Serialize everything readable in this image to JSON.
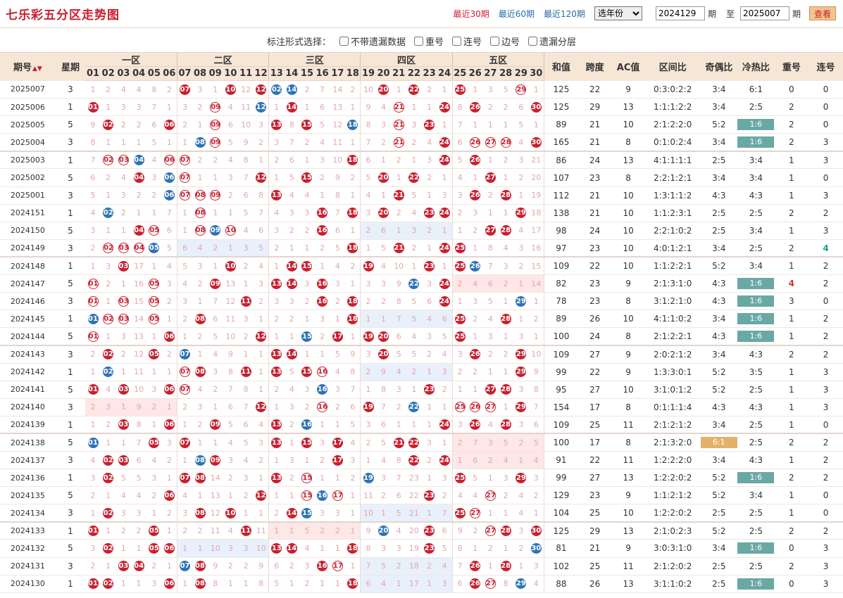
{
  "title": "七乐彩五分区走势图",
  "toolbar": {
    "links": [
      "最近30期",
      "最近60期",
      "最近120期"
    ],
    "year_select": "选年份",
    "from_value": "2024129",
    "issue_suffix": "期",
    "to_label": "至",
    "to_value": "2025007",
    "query": "查看"
  },
  "options": {
    "label": "标注形式选择：",
    "items": [
      "不带遗漏数据",
      "重号",
      "连号",
      "边号",
      "遗漏分层"
    ]
  },
  "headers": {
    "issue": "期号",
    "week": "星期",
    "zones": [
      "一区",
      "二区",
      "三区",
      "四区",
      "五区"
    ],
    "stats": [
      "和值",
      "跨度",
      "AC值",
      "区间比",
      "奇偶比",
      "冷热比",
      "重号",
      "连号"
    ]
  },
  "rows": [
    {
      "issue": "2025007",
      "week": "3",
      "cells": "-1 -2 -4 -4 -8 -2 R7 -3 -1 R10 -12 R12 B2 B14 -2 -7 -14 -2 -10 R20 -1 R22 -2 -1 R25 -1 -3 -5 O29 -1",
      "hs": 125,
      "kd": 22,
      "ac": 9,
      "qj": "0:3:0:2:2",
      "jo": "3:4",
      "lr": "6:1",
      "cf": 0,
      "lh": 0
    },
    {
      "issue": "2025006",
      "week": "1",
      "cells": "R1 -1 -3 -3 -7 -1 -3 -2 O9 -4 -11 B12 -1 R14 -1 -6 -13 -1 -9 -4 O21 -1 -1 R24 -8 R26 -2 -2 -6 R30",
      "hs": 125,
      "kd": 29,
      "ac": 13,
      "qj": "1:1:1:2:2",
      "jo": "3:4",
      "lr": "2:5",
      "cf": 2,
      "lh": 0
    },
    {
      "issue": "2025005",
      "week": "5",
      "cells": "-9 R2 -2 -2 -6 R6 -2 -1 O9 -6 -10 -3 R13 -8 R15 -5 -12 B18 -8 -3 O21 -3 R23 -1 -7 -1 -1 -1 -5 -1",
      "hs": 89,
      "kd": 21,
      "ac": 10,
      "qj": "2:1:2:2:0",
      "jo": "5:2",
      "lr": "1:6",
      "lrBadge": "teal",
      "cf": 2,
      "lh": 0
    },
    {
      "issue": "2025004",
      "week": "3",
      "cells": "-8 -1 -1 -1 -5 -1 -1 B8 O9 -5 -9 -2 -3 -7 -2 -4 -11 -1 -7 -2 O21 -2 -4 R24 -6 O26 O27 O28 -4 R30",
      "hs": 165,
      "kd": 21,
      "ac": 8,
      "qj": "0:1:0:2:4",
      "jo": "3:4",
      "lr": "1:6",
      "lrBadge": "teal",
      "cf": 2,
      "lh": 3,
      "group": true
    },
    {
      "issue": "2025003",
      "week": "1",
      "cells": "-7 O2 O3 B4 -4 O6 O7 -2 -2 -4 -8 -1 -2 -6 -1 -3 -10 R18 -6 -1 -2 -1 -3 R24 -5 R26 -1 -2 -3 -21",
      "hs": 86,
      "kd": 24,
      "ac": 13,
      "qj": "4:1:1:1:1",
      "jo": "2:5",
      "lr": "3:4",
      "cf": 1,
      "lh": 3
    },
    {
      "issue": "2025002",
      "week": "5",
      "cells": "-6 -2 -4 R4 -3 B6 O7 -1 -1 -3 -7 R12 -1 -5 R15 -2 -9 -2 -5 R20 -1 R22 -2 -1 -4 -1 R27 -1 -2 -20",
      "hs": 107,
      "kd": 23,
      "ac": 8,
      "qj": "2:2:1:2:1",
      "jo": "3:4",
      "lr": "3:4",
      "cf": 1,
      "lh": 0
    },
    {
      "issue": "2025001",
      "week": "3",
      "cells": "-5 -1 -3 -2 -2 B6 O7 O8 O9 -2 -6 -8 R13 -4 -4 -1 -8 -1 -4 -1 R21 -5 -1 -3 -3 R26 -2 R28 -1 -19",
      "hs": 112,
      "kd": 21,
      "ac": 10,
      "qj": "1:3:1:1:2",
      "jo": "4:3",
      "lr": "4:3",
      "cf": 1,
      "lh": 3
    },
    {
      "issue": "2024151",
      "week": "1",
      "cells": "-4 B2 -2 -1 -1 -7 -1 O8 -1 -1 -5 -7 -4 -3 -3 R16 -7 R18 -3 R20 -2 -4 R23 R24 -2 -3 -1 -1 R29 -18",
      "hs": 138,
      "kd": 21,
      "ac": 10,
      "qj": "1:1:2:3:1",
      "jo": "2:5",
      "lr": "2:5",
      "cf": 2,
      "lh": 2
    },
    {
      "issue": "2024150",
      "week": "5",
      "cells": "-3 -1 -1 R4 O5 -6 -1 O8 B9 O10 -4 -6 -3 -2 -2 R16 -6 -1 -2 -6 -1 -3 -2 -1 -1 -2 R27 R28 -4 -17",
      "hs": 98,
      "kd": 24,
      "ac": 10,
      "qj": "2:2:1:0:2",
      "jo": "2:5",
      "lr": "3:4",
      "cf": 1,
      "lh": 3,
      "hl": [
        [
          18,
          24,
          "blue"
        ]
      ]
    },
    {
      "issue": "2024149",
      "week": "3",
      "cells": "-2 O2 O3 O4 B5 -5 -6 -4 -2 -1 -3 -5 -2 -1 -1 -2 -5 R18 -1 -5 R21 -2 -1 R24 R25 -1 -8 -4 -3 -16",
      "hs": 97,
      "kd": 23,
      "ac": 10,
      "qj": "4:0:1:2:1",
      "jo": "3:4",
      "lr": "2:5",
      "cf": 2,
      "lh": 4,
      "lhSpecial": true,
      "group": true,
      "hl": [
        [
          6,
          12,
          "blue"
        ]
      ]
    },
    {
      "issue": "2024148",
      "week": "1",
      "cells": "-1 -3 R3 -17 -1 -4 -5 -3 -1 R10 -2 -4 -1 R14 R15 -1 -4 -2 R19 -4 -10 -1 R23 -1 R25 B26 -7 -3 -2 -15",
      "hs": 109,
      "kd": 22,
      "ac": 10,
      "qj": "1:1:2:2:1",
      "jo": "5:2",
      "lr": "3:4",
      "cf": 1,
      "lh": 2
    },
    {
      "issue": "2024147",
      "week": "5",
      "cells": "O1 -2 -1 -16 O5 -3 -4 -2 R9 -13 -1 -3 R13 R14 -3 R16 -3 -1 -3 -3 -9 B22 -3 R24 -2 -4 -6 -2 -1 -14",
      "hs": 82,
      "kd": 23,
      "ac": 9,
      "qj": "2:1:3:1:0",
      "jo": "4:3",
      "lr": "1:6",
      "lrBadge": "teal",
      "cf": 4,
      "cfSpecial": true,
      "lh": 2,
      "hl": [
        [
          24,
          30,
          "red"
        ]
      ]
    },
    {
      "issue": "2024146",
      "week": "3",
      "cells": "O1 -1 O3 -15 O5 -2 -3 -1 -7 -12 R11 -2 -3 -3 -2 R16 -2 R18 -2 -2 -8 -5 -6 R24 -1 -3 -5 -1 B29 -1",
      "hs": 78,
      "kd": 23,
      "ac": 8,
      "qj": "3:1:2:1:0",
      "jo": "4:3",
      "lr": "1:6",
      "lrBadge": "teal",
      "cf": 3,
      "lh": 0
    },
    {
      "issue": "2024145",
      "week": "1",
      "cells": "B1 O2 O3 -14 O5 -1 -2 R8 -6 -11 -3 -1 -2 -2 -1 -3 -1 R18 -1 -1 -7 -5 -4 -6 R25 -2 -4 R28 -1 -2",
      "hs": 89,
      "kd": 26,
      "ac": 10,
      "qj": "4:1:1:0:2",
      "jo": "3:4",
      "lr": "1:6",
      "lrBadge": "teal",
      "cf": 1,
      "lh": 2,
      "hl": [
        [
          18,
          24,
          "blue"
        ]
      ]
    },
    {
      "issue": "2024144",
      "week": "5",
      "cells": "O1 -1 -3 -13 -1 R6 -1 -2 -5 -10 -2 R12 -1 -1 B15 -2 R17 -1 R19 R20 -6 -4 -3 -5 R25 -1 -3 -1 -3 -1",
      "hs": 100,
      "kd": 24,
      "ac": 8,
      "qj": "2:1:2:2:1",
      "jo": "4:3",
      "lr": "1:6",
      "lrBadge": "teal",
      "cf": 1,
      "lh": 2,
      "group": true
    },
    {
      "issue": "2024143",
      "week": "3",
      "cells": "-2 R2 -2 -12 R5 -2 B7 -1 -4 -9 -1 -1 R13 R14 -1 -1 -5 -9 -3 R20 -5 -5 -2 -4 -3 R26 -2 -2 R29 -10",
      "hs": 109,
      "kd": 27,
      "ac": 9,
      "qj": "2:0:2:1:2",
      "jo": "3:4",
      "lr": "4:3",
      "cf": 2,
      "lh": 2
    },
    {
      "issue": "2024142",
      "week": "1",
      "cells": "-1 B2 -1 -11 -1 -1 O7 R8 -3 -8 R11 -1 R13 -5 R15 O16 -4 -8 -2 -9 -4 -2 -1 -3 -2 -2 -1 -1 R29 -9",
      "hs": 99,
      "kd": 22,
      "ac": 9,
      "qj": "1:3:3:0:1",
      "jo": "5:2",
      "lr": "3:5",
      "cf": 1,
      "lh": 3,
      "hl": [
        [
          18,
          24,
          "blue"
        ]
      ]
    },
    {
      "issue": "2024141",
      "week": "5",
      "cells": "R1 -4 R3 -10 -3 R6 O7 -4 -2 -7 -8 -1 -2 -4 -3 B16 -3 -7 -1 -8 -3 -1 R23 -2 -1 -1 R27 R28 -3 -8",
      "hs": 95,
      "kd": 27,
      "ac": 10,
      "qj": "3:1:0:1:2",
      "jo": "5:2",
      "lr": "2:5",
      "cf": 1,
      "lh": 3
    },
    {
      "issue": "2024140",
      "week": "3",
      "cells": "-2 -3 -1 -9 -2 -1 -2 -3 -1 -6 -7 R12 -1 -3 -2 O16 -2 -6 R19 -7 -2 B22 -1 -1 O25 O26 O27 -1 R29 -7",
      "hs": 154,
      "kd": 17,
      "ac": 8,
      "qj": "0:1:1:1:4",
      "jo": "4:3",
      "lr": "4:3",
      "cf": 1,
      "lh": 3,
      "hl": [
        [
          0,
          6,
          "red"
        ]
      ]
    },
    {
      "issue": "2024139",
      "week": "1",
      "cells": "-1 -2 R3 -8 -1 R6 -1 -2 R9 -5 -6 -4 R13 -2 B16 -1 -1 -5 -3 -6 -1 -1 -1 R24 -3 R26 -4 R28 -3 -6",
      "hs": 109,
      "kd": 25,
      "ac": 11,
      "qj": "2:1:2:1:2",
      "jo": "3:4",
      "lr": "2:5",
      "cf": 1,
      "lh": 0,
      "group": true
    },
    {
      "issue": "2024138",
      "week": "5",
      "cells": "B1 -1 -1 -7 R5 -3 R7 -1 -1 -4 -5 -3 R13 -1 R15 -3 R17 -4 -2 -5 R21 R22 -3 -1 -2 -7 -3 -5 -2 -5",
      "hs": 100,
      "kd": 17,
      "ac": 8,
      "qj": "2:1:3:2:0",
      "jo": "6:1",
      "joBadge": "gold",
      "lr": "2:5",
      "cf": 2,
      "lh": 2,
      "hl": [
        [
          24,
          30,
          "red"
        ]
      ]
    },
    {
      "issue": "2024137",
      "week": "3",
      "cells": "-4 R2 R3 -6 -4 -2 -1 B8 R9 -3 -4 -2 -1 -3 -1 -2 R17 -3 -1 -4 -8 R22 -2 R24 -1 -6 -2 -4 -1 -4",
      "hs": 91,
      "kd": 22,
      "ac": 11,
      "qj": "1:2:2:2:0",
      "jo": "3:4",
      "lr": "4:3",
      "cf": 1,
      "lh": 2,
      "hl": [
        [
          24,
          30,
          "red"
        ]
      ]
    },
    {
      "issue": "2024136",
      "week": "1",
      "cells": "-3 R2 -5 -5 -3 -1 R7 R8 -14 -2 -3 -1 R13 -2 O15 -1 -1 -2 B19 -3 -7 -23 -1 -3 R25 -5 -1 -3 R29 -3",
      "hs": 99,
      "kd": 27,
      "ac": 13,
      "qj": "1:2:2:0:2",
      "jo": "5:2",
      "lr": "1:6",
      "lrBadge": "teal",
      "cf": 2,
      "lh": 2
    },
    {
      "issue": "2024135",
      "week": "5",
      "cells": "-2 -1 -4 -4 -2 R6 -4 -1 -13 -1 -2 R12 -1 -1 O15 B16 O17 -1 -11 -2 -6 -22 R23 -2 -4 -4 O27 -2 -4 -2",
      "hs": 129,
      "kd": 23,
      "ac": 9,
      "qj": "1:1:2:1:2",
      "jo": "5:2",
      "lr": "3:4",
      "cf": 1,
      "lh": 0
    },
    {
      "issue": "2024134",
      "week": "3",
      "cells": "-1 R2 -3 -3 -1 -2 -3 R8 -12 R10 -1 -1 -2 R14 B15 -3 -3 -1 -10 -1 -5 -21 -1 -7 R25 O27 -1 -1 -4 -1",
      "hs": 104,
      "kd": 25,
      "ac": 10,
      "qj": "1:2:2:0:2",
      "jo": "2:5",
      "lr": "2:5",
      "cf": 1,
      "lh": 0,
      "group": true,
      "hl": [
        [
          18,
          24,
          "blue"
        ]
      ]
    },
    {
      "issue": "2024133",
      "week": "1",
      "cells": "R1 -1 -2 -2 R5 -1 -2 -2 -11 -4 R11 -11 -1 -1 -5 -2 -2 -1 -9 B20 -4 -20 R23 -6 -9 -2 O27 R28 -3 R30",
      "hs": 125,
      "kd": 29,
      "ac": 13,
      "qj": "2:1:0:2:3",
      "jo": "5:2",
      "lr": "2:5",
      "cf": 2,
      "lh": 2,
      "hl": [
        [
          12,
          18,
          "red"
        ]
      ]
    },
    {
      "issue": "2024132",
      "week": "5",
      "cells": "-3 R2 -1 -1 R5 R6 -1 -1 -10 -3 -3 -10 R13 R14 -4 -1 -1 R18 -8 -3 -3 -19 R23 -5 -8 -1 -2 -1 -2 B30",
      "hs": 81,
      "kd": 21,
      "ac": 9,
      "qj": "3:0:3:1:0",
      "jo": "3:4",
      "lr": "1:6",
      "lrBadge": "teal",
      "cf": 0,
      "lh": 3,
      "hl": [
        [
          6,
          12,
          "blue"
        ]
      ]
    },
    {
      "issue": "2024131",
      "week": "3",
      "cells": "-2 -1 R3 R4 -2 -1 B7 R8 -9 -2 -2 -9 -6 -2 -3 R16 O17 -1 -7 -5 -2 -18 -2 -4 -7 R26 -1 R28 -1 -3",
      "hs": 102,
      "kd": 25,
      "ac": 11,
      "qj": "2:1:2:0:2",
      "jo": "2:5",
      "lr": "2:5",
      "cf": 2,
      "lh": 3,
      "hl": [
        [
          18,
          24,
          "blue"
        ]
      ]
    },
    {
      "issue": "2024130",
      "week": "1",
      "cells": "R1 R2 -1 -1 -3 R6 -1 R8 -8 -1 -1 -8 -5 -1 -2 -1 -1 R18 -6 -4 -1 -17 -1 -3 -6 R26 O27 -8 B29 -4",
      "hs": 88,
      "kd": 26,
      "ac": 13,
      "qj": "3:1:1:0:2",
      "jo": "2:5",
      "lr": "1:6",
      "lrBadge": "teal",
      "cf": 0,
      "lh": 3,
      "hl": [
        [
          18,
          24,
          "blue"
        ]
      ]
    }
  ]
}
